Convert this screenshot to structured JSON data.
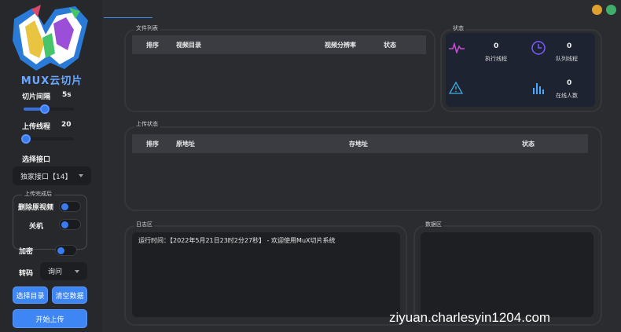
{
  "sidebar": {
    "logo_text": "MUX云切片",
    "slice_interval": {
      "label": "切片间隔",
      "value": "5s",
      "level": 0.42
    },
    "upload_threads": {
      "label": "上传线程",
      "value": "20",
      "level": 0.05
    },
    "select_api": {
      "label": "选择接口",
      "selected": "独家接口【14】"
    },
    "after_upload": {
      "title": "上传完成后",
      "delete_source": {
        "label": "删除原视频",
        "on": false
      },
      "shutdown": {
        "label": "关机",
        "on": false
      }
    },
    "encrypt": {
      "label": "加密",
      "on": false
    },
    "transcode": {
      "label": "转码",
      "selected": "询问"
    },
    "buttons": {
      "select_dir": "选择目录",
      "clear_data": "清空数据",
      "start_upload": "开始上传"
    }
  },
  "file_list": {
    "title": "文件列表",
    "columns": [
      "排序",
      "视频目录",
      "视频分辨率",
      "状态"
    ],
    "rows": []
  },
  "status": {
    "title": "状态",
    "exec_threads": {
      "value": "0",
      "label": "执行线程"
    },
    "queue_threads": {
      "value": "0",
      "label": "队列线程"
    },
    "online_users": {
      "value": "0",
      "label": "在线人数"
    }
  },
  "upload_status": {
    "title": "上传状态",
    "columns": [
      "排序",
      "原地址",
      "存地址",
      "状态"
    ],
    "rows": []
  },
  "log": {
    "title": "日志区",
    "lines": [
      "运行时间：【2022年5月21日23时2分27秒】 - 欢迎使用MuX切片系统"
    ]
  },
  "data_area": {
    "title": "数据区"
  },
  "colors": {
    "accent": "#3f86f5",
    "minimize": "#e0a030",
    "maximize": "#3fae6a",
    "pulse": "#c94fd6",
    "clock": "#7a5cff",
    "warning": "#3fb0e0",
    "bars": "#4aa8ff"
  },
  "watermark": "ziyuan.charlesyin1204.com"
}
